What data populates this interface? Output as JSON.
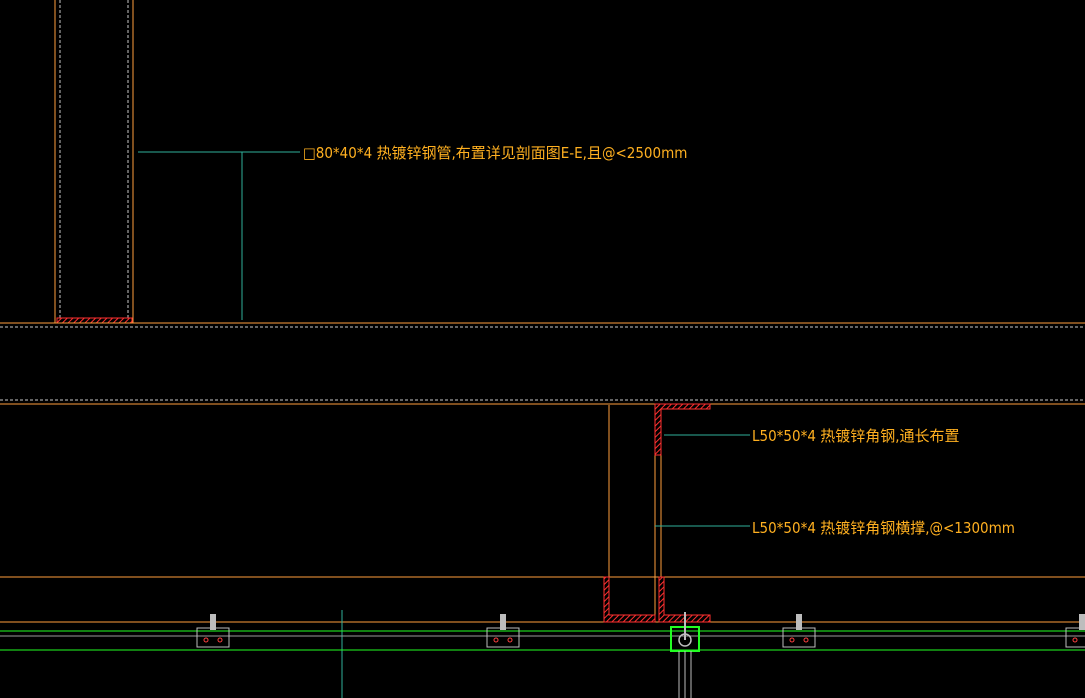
{
  "drawing": {
    "background": "#000000",
    "colors": {
      "outline": "#ff9e3d",
      "dashed": "#c8c8c8",
      "hatch": "#ff3030",
      "leader": "#2fb09a",
      "label": "#ffb020",
      "rail": "#22ff22",
      "clip": "#bdbdbd"
    },
    "annotations": {
      "tube": "□80*40*4 热镀锌钢管,布置详见剖面图E-E,且@<2500mm",
      "angle_top": "L50*50*4 热镀锌角钢,通长布置",
      "angle_vertical": "L50*50*4 热镀锌角钢横撑,@<1300mm"
    }
  }
}
